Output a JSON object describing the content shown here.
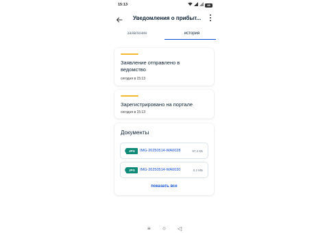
{
  "status_bar": {
    "time": "15:13",
    "battery": "48"
  },
  "app_bar": {
    "title": "Уведомления о прибыт..."
  },
  "tabs": [
    {
      "label": "заявление",
      "active": false
    },
    {
      "label": "история",
      "active": true
    }
  ],
  "events": [
    {
      "title": "Заявление отправлено в ведомство",
      "time": "сегодня в 15:13"
    },
    {
      "title": "Зарегистрировано на портале",
      "time": "сегодня в 15:13"
    }
  ],
  "documents": {
    "title": "Документы",
    "files": [
      {
        "type": "JPG",
        "name": "IMG-20250514-WA0028",
        "size": "97,4 КБ"
      },
      {
        "type": "JPG",
        "name": "IMG-20250514-WA0030",
        "size": "0,2 МБ"
      }
    ],
    "show_all": "показать все"
  },
  "nav": {
    "menu": "≡",
    "home": "○",
    "back": "◁"
  },
  "colors": {
    "accent": "#f5b82e",
    "link": "#0d4cd3",
    "file_badge": "#0c8a77",
    "text": "#0b1f33"
  }
}
